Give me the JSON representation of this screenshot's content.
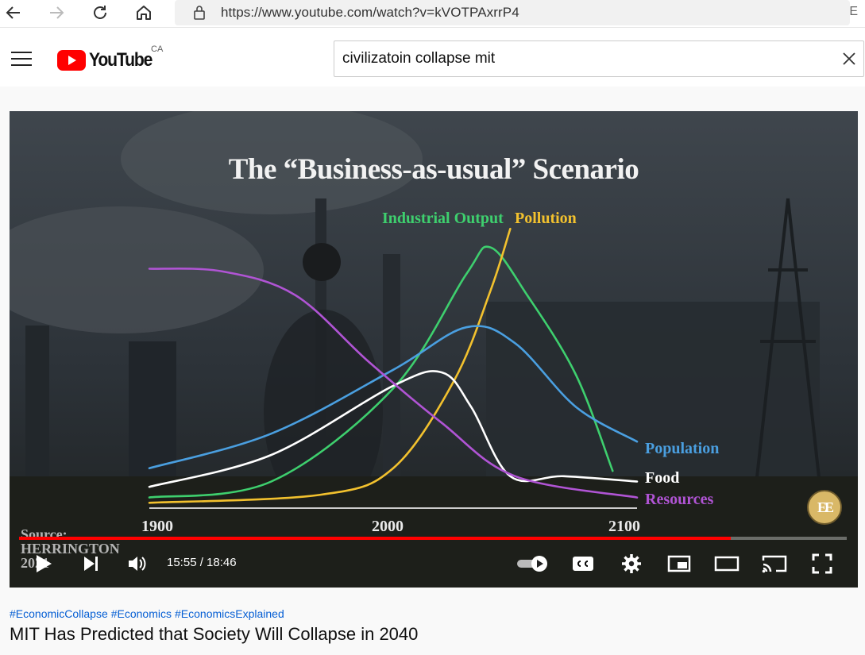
{
  "browser": {
    "url": "https://www.youtube.com/watch?v=kVOTPAxrrP4",
    "url_trailing_glyph": "E"
  },
  "youtube": {
    "logo_text": "YouTube",
    "region": "CA",
    "search_value": "civilizatoin collapse mit"
  },
  "player": {
    "time": "15:55 / 18:46",
    "progress_percent": 86,
    "source_line1": "Source:",
    "source_line2": "HERRINGTON",
    "source_line3": "2021",
    "channel_badge": "EE"
  },
  "chart_data": {
    "type": "line",
    "title": "The “Business-as-usual” Scenario",
    "x_ticks": [
      "1900",
      "2000",
      "2100"
    ],
    "xlim": [
      1900,
      2100
    ],
    "series": [
      {
        "name": "Industrial Output",
        "color": "#3ecf6e",
        "points": [
          [
            1900,
            0.04
          ],
          [
            1950,
            0.1
          ],
          [
            2000,
            0.45
          ],
          [
            2030,
            0.88
          ],
          [
            2040,
            0.98
          ],
          [
            2055,
            0.8
          ],
          [
            2075,
            0.5
          ],
          [
            2090,
            0.14
          ]
        ]
      },
      {
        "name": "Pollution",
        "color": "#f2c12e",
        "points": [
          [
            1900,
            0.02
          ],
          [
            1970,
            0.05
          ],
          [
            2000,
            0.15
          ],
          [
            2025,
            0.48
          ],
          [
            2040,
            0.82
          ],
          [
            2048,
            1.05
          ]
        ]
      },
      {
        "name": "Population",
        "color": "#4a9fe0",
        "points": [
          [
            1900,
            0.15
          ],
          [
            1950,
            0.28
          ],
          [
            2000,
            0.52
          ],
          [
            2030,
            0.68
          ],
          [
            2050,
            0.62
          ],
          [
            2075,
            0.38
          ],
          [
            2100,
            0.25
          ]
        ]
      },
      {
        "name": "Food",
        "color": "#ffffff",
        "points": [
          [
            1900,
            0.08
          ],
          [
            1950,
            0.2
          ],
          [
            2000,
            0.46
          ],
          [
            2020,
            0.51
          ],
          [
            2032,
            0.38
          ],
          [
            2048,
            0.12
          ],
          [
            2070,
            0.12
          ],
          [
            2100,
            0.1
          ]
        ]
      },
      {
        "name": "Resources",
        "color": "#b054d4",
        "points": [
          [
            1900,
            0.9
          ],
          [
            1930,
            0.89
          ],
          [
            1960,
            0.8
          ],
          [
            1990,
            0.55
          ],
          [
            2020,
            0.32
          ],
          [
            2050,
            0.12
          ],
          [
            2100,
            0.04
          ]
        ]
      }
    ]
  },
  "below": {
    "hashtags": [
      "#EconomicCollapse",
      "#Economics",
      "#EconomicsExplained"
    ],
    "title": "MIT Has Predicted that Society Will Collapse in 2040"
  }
}
